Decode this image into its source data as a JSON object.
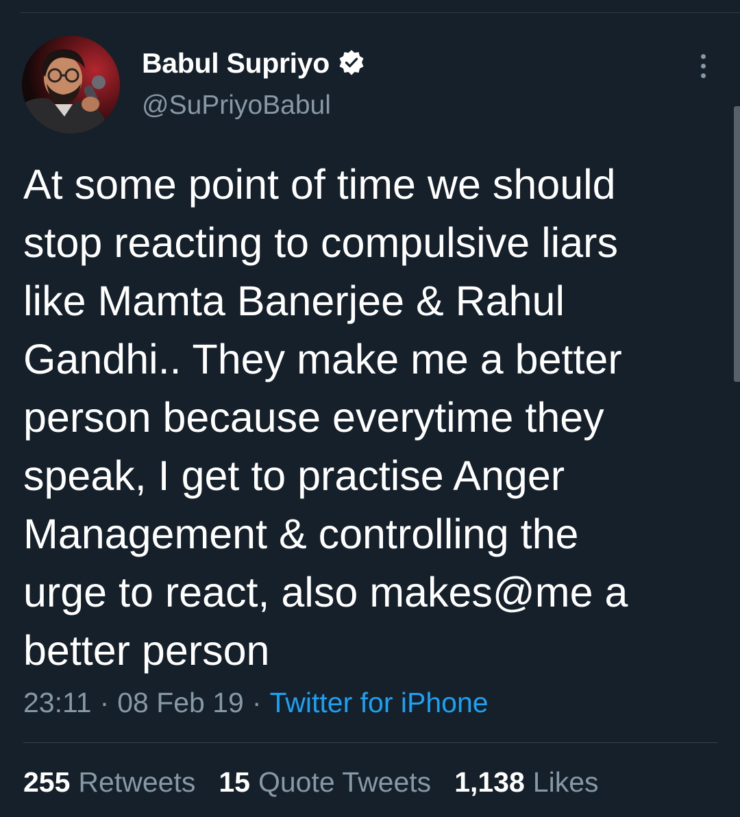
{
  "tweet": {
    "author": {
      "display_name": "Babul Supriyo",
      "handle": "@SuPriyoBabul",
      "verified": true
    },
    "text": "At some point of time we should\nstop reacting to compulsive liars\nlike Mamta Banerjee & Rahul\nGandhi.. They make me a better\nperson because everytime they\nspeak, I get to practise Anger\nManagement & controlling the\nurge to react, also makes@me a\nbetter person",
    "time": "23:11",
    "date": "08 Feb 19",
    "separator": "·",
    "source": "Twitter for iPhone"
  },
  "stats": {
    "retweets": {
      "count": "255",
      "label": "Retweets"
    },
    "quote_tweets": {
      "count": "15",
      "label": "Quote Tweets"
    },
    "likes": {
      "count": "1,138",
      "label": "Likes"
    }
  },
  "icons": {
    "verified": "verified-badge-icon",
    "more": "more-vertical-icon"
  },
  "colors": {
    "background": "#15202b",
    "text": "#ffffff",
    "secondary_text": "#8899a6",
    "link": "#1da1f2",
    "divider": "#38444d"
  }
}
